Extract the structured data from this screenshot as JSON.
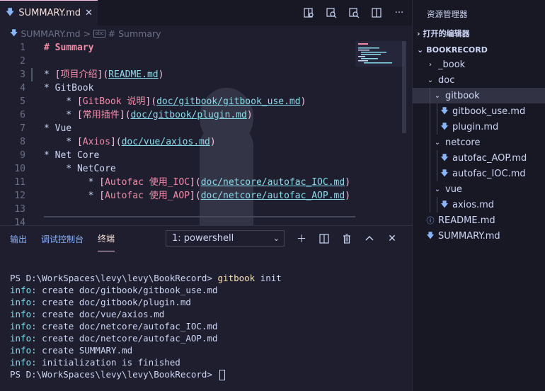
{
  "tab": {
    "label": "SUMMARY.md",
    "icon": "markdown-icon"
  },
  "breadcrumb": {
    "file": "SUMMARY.md",
    "separator": ">",
    "symbol_badge": "abc",
    "symbol": "# Summary"
  },
  "editor": {
    "line_numbers": [
      "1",
      "2",
      "3",
      "4",
      "5",
      "6",
      "7",
      "8",
      "9",
      "10",
      "11",
      "12",
      "13",
      "14"
    ],
    "lines": [
      [
        {
          "t": "# Summary",
          "c": "c-h"
        }
      ],
      [],
      [
        {
          "t": "* ",
          "c": "c-bul"
        },
        {
          "t": "[",
          "c": "c-br"
        },
        {
          "t": "项目介绍",
          "c": "c-lt"
        },
        {
          "t": "](",
          "c": "c-br"
        },
        {
          "t": "README.md",
          "c": "c-url"
        },
        {
          "t": ")",
          "c": "c-br"
        }
      ],
      [
        {
          "t": "* GitBook",
          "c": "c-txt"
        }
      ],
      [
        {
          "t": "    * ",
          "c": "c-bul"
        },
        {
          "t": "[",
          "c": "c-br"
        },
        {
          "t": "GitBook 说明",
          "c": "c-lt"
        },
        {
          "t": "](",
          "c": "c-br"
        },
        {
          "t": "doc/gitbook/gitbook_use.md",
          "c": "c-url"
        },
        {
          "t": ")",
          "c": "c-br"
        }
      ],
      [
        {
          "t": "    * ",
          "c": "c-bul"
        },
        {
          "t": "[",
          "c": "c-br"
        },
        {
          "t": "常用插件",
          "c": "c-lt"
        },
        {
          "t": "](",
          "c": "c-br"
        },
        {
          "t": "doc/gitbook/plugin.md",
          "c": "c-url"
        },
        {
          "t": ")",
          "c": "c-br"
        }
      ],
      [
        {
          "t": "* Vue",
          "c": "c-txt"
        }
      ],
      [
        {
          "t": "    * ",
          "c": "c-bul"
        },
        {
          "t": "[",
          "c": "c-br"
        },
        {
          "t": "Axios",
          "c": "c-lt"
        },
        {
          "t": "](",
          "c": "c-br"
        },
        {
          "t": "doc/vue/axios.md",
          "c": "c-url"
        },
        {
          "t": ")",
          "c": "c-br"
        }
      ],
      [
        {
          "t": "* Net Core",
          "c": "c-txt"
        }
      ],
      [
        {
          "t": "    * NetCore",
          "c": "c-txt"
        }
      ],
      [
        {
          "t": "        * ",
          "c": "c-bul"
        },
        {
          "t": "[",
          "c": "c-br"
        },
        {
          "t": "Autofac 使用_IOC",
          "c": "c-lt"
        },
        {
          "t": "](",
          "c": "c-br"
        },
        {
          "t": "doc/netcore/autofac_IOC.md",
          "c": "c-url"
        },
        {
          "t": ")",
          "c": "c-br"
        }
      ],
      [
        {
          "t": "        * ",
          "c": "c-bul"
        },
        {
          "t": "[",
          "c": "c-br"
        },
        {
          "t": "Autofac 使用_AOP",
          "c": "c-lt"
        },
        {
          "t": "](",
          "c": "c-br"
        },
        {
          "t": "doc/netcore/autofac_AOP.md",
          "c": "c-url"
        },
        {
          "t": ")",
          "c": "c-br"
        }
      ],
      [],
      []
    ]
  },
  "panel": {
    "tabs": [
      "输出",
      "调试控制台",
      "终端"
    ],
    "active_tab": "终端",
    "terminal_select": "1: powershell",
    "terminal_lines": [
      [],
      [
        {
          "t": "PS D:\\WorkSpaces\\levy\\levy\\BookRecord> ",
          "c": ""
        },
        {
          "t": "gitbook",
          "c": "t-cmd"
        },
        {
          "t": " init",
          "c": ""
        }
      ],
      [
        {
          "t": "info:",
          "c": "t-info"
        },
        {
          "t": " create doc/gitbook/gitbook_use.md",
          "c": ""
        }
      ],
      [
        {
          "t": "info:",
          "c": "t-info"
        },
        {
          "t": " create doc/gitbook/plugin.md",
          "c": ""
        }
      ],
      [
        {
          "t": "info:",
          "c": "t-info"
        },
        {
          "t": " create doc/vue/axios.md",
          "c": ""
        }
      ],
      [
        {
          "t": "info:",
          "c": "t-info"
        },
        {
          "t": " create doc/netcore/autofac_IOC.md",
          "c": ""
        }
      ],
      [
        {
          "t": "info:",
          "c": "t-info"
        },
        {
          "t": " create doc/netcore/autofac_AOP.md",
          "c": ""
        }
      ],
      [
        {
          "t": "info:",
          "c": "t-info"
        },
        {
          "t": " create SUMMARY.md",
          "c": ""
        }
      ],
      [
        {
          "t": "info:",
          "c": "t-info"
        },
        {
          "t": " initialization is finished",
          "c": ""
        }
      ],
      [
        {
          "t": "PS D:\\WorkSpaces\\levy\\levy\\BookRecord> ",
          "c": ""
        }
      ]
    ]
  },
  "explorer": {
    "title": "资源管理器",
    "open_editors": "打开的编辑器",
    "root": "BOOKRECORD",
    "items": [
      {
        "label": "_book",
        "depth": 0,
        "kind": "folder",
        "open": false
      },
      {
        "label": "doc",
        "depth": 0,
        "kind": "folder",
        "open": true
      },
      {
        "label": "gitbook",
        "depth": 1,
        "kind": "folder",
        "open": true,
        "selected": true
      },
      {
        "label": "gitbook_use.md",
        "depth": 2,
        "kind": "md"
      },
      {
        "label": "plugin.md",
        "depth": 2,
        "kind": "md"
      },
      {
        "label": "netcore",
        "depth": 1,
        "kind": "folder",
        "open": true
      },
      {
        "label": "autofac_AOP.md",
        "depth": 2,
        "kind": "md"
      },
      {
        "label": "autofac_IOC.md",
        "depth": 2,
        "kind": "md"
      },
      {
        "label": "vue",
        "depth": 1,
        "kind": "folder",
        "open": true
      },
      {
        "label": "axios.md",
        "depth": 2,
        "kind": "md"
      },
      {
        "label": "README.md",
        "depth": 0,
        "kind": "info"
      },
      {
        "label": "SUMMARY.md",
        "depth": 0,
        "kind": "md"
      }
    ]
  }
}
